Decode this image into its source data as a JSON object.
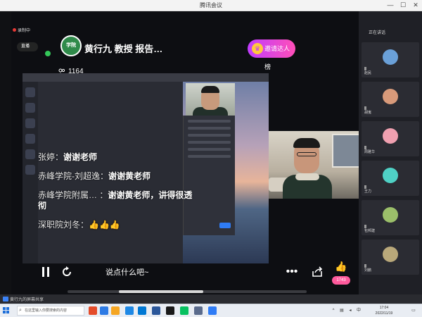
{
  "window": {
    "title": "腾讯会议",
    "controls": [
      "—",
      "☐",
      "✕"
    ]
  },
  "recording": {
    "label": "录制中"
  },
  "live_badge": {
    "label": "直播"
  },
  "host": {
    "logo_text": "学院",
    "name": "黄行九 教授 报告…"
  },
  "viewers": {
    "icon": "people-icon",
    "count": "1164"
  },
  "invite": {
    "icon": "trophy-icon",
    "label": "邀请达人榜"
  },
  "chat": [
    {
      "sender": "张婷",
      "sep": "：",
      "message": "谢谢老师"
    },
    {
      "sender": "赤峰学院-刘超逸",
      "sep": "：",
      "message": "谢谢黄老师"
    },
    {
      "sender": "赤峰学院附属…",
      "sep": " ：",
      "message": "谢谢黄老师，讲得很透彻"
    },
    {
      "sender": "深职院刘冬",
      "sep": "：",
      "message": "👍👍👍"
    }
  ],
  "controls": {
    "pause_icon": "pause-icon",
    "refresh_icon": "refresh-icon",
    "chat_placeholder": "说点什么吧~",
    "more_icon": "more-icon",
    "share_icon": "share-icon",
    "like_icon": "thumbs-up-icon",
    "like_count": "1743"
  },
  "scroll": {
    "position_fraction": 0.33
  },
  "share_banner": {
    "label": "黄行九的屏幕共享"
  },
  "participants": {
    "header": "正在讲话",
    "items": [
      {
        "name": "赵民",
        "color": "#6aa0d8"
      },
      {
        "name": "胡嵬",
        "color": "#d89a7a"
      },
      {
        "name": "周雅华",
        "color": "#f0a0b0"
      },
      {
        "name": "王力",
        "color": "#4fd1c5"
      },
      {
        "name": "包邦建",
        "color": "#9bbf6a"
      },
      {
        "name": "刘鹏",
        "color": "#b9a87a"
      }
    ]
  },
  "taskbar": {
    "search_placeholder": "在这里输入你要搜索的内容",
    "apps": [
      "#e44c2a",
      "#2d7be5",
      "#f5a623",
      "#1e88e5",
      "#0078d4",
      "#2b579a",
      "#1a1a1a",
      "#07c160",
      "#5a6b8c",
      "#2f7cf6"
    ],
    "time": "17:04",
    "date": "2022/11/19"
  }
}
